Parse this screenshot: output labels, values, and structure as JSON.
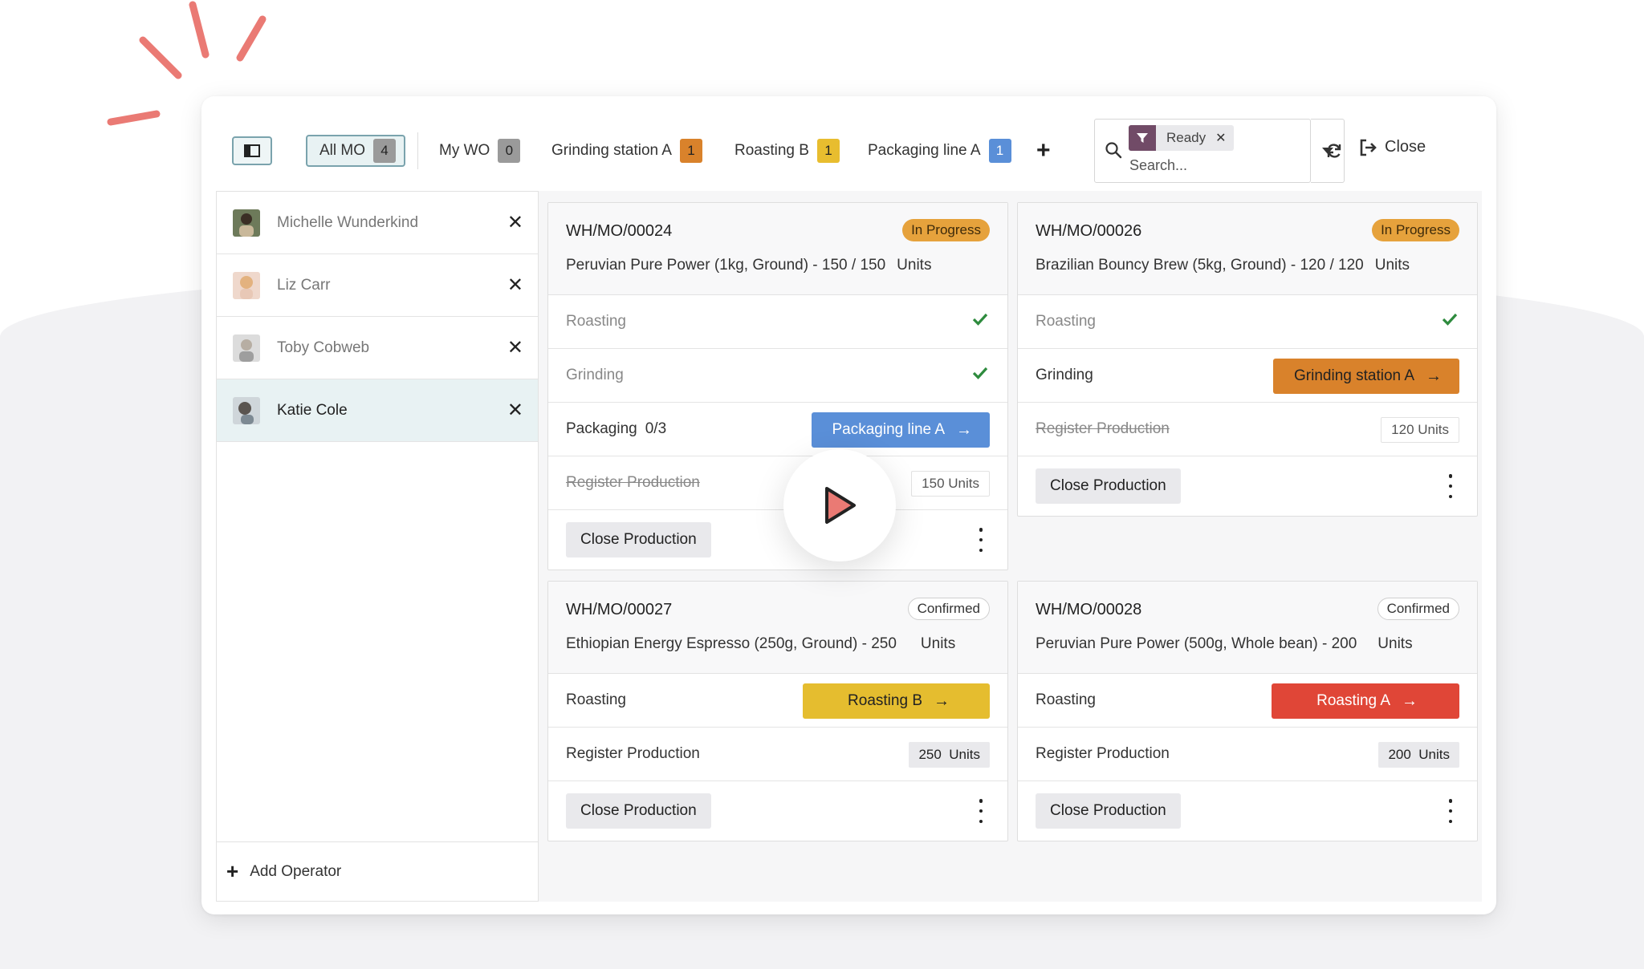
{
  "brand": {
    "accent": "#714b67",
    "sparkle": "#ea7a74"
  },
  "topbar": {
    "panel_toggle_icon": "sidebar-panel-icon",
    "tabs": [
      {
        "label": "All MO",
        "count": "4",
        "active": true,
        "badge_color": "#9a9a9a"
      },
      {
        "label": "My WO",
        "count": "0",
        "active": false,
        "badge_color": "#9a9a9a"
      },
      {
        "label": "Grinding station A",
        "count": "1",
        "active": false,
        "badge_color": "#d9822b"
      },
      {
        "label": "Roasting B",
        "count": "1",
        "active": false,
        "badge_color": "#e8bd2f"
      },
      {
        "label": "Packaging line A",
        "count": "1",
        "active": false,
        "badge_color": "#5a8fd8"
      }
    ],
    "add_tab_label": "+",
    "search": {
      "facet": "Ready",
      "facet_icon": "filter-icon",
      "placeholder": "Search..."
    },
    "refresh_icon": "refresh-icon",
    "close_label": "Close"
  },
  "operators": [
    {
      "name": "Michelle Wunderkind",
      "selected": false
    },
    {
      "name": "Liz Carr",
      "selected": false
    },
    {
      "name": "Toby Cobweb",
      "selected": false
    },
    {
      "name": "Katie Cole",
      "selected": true
    }
  ],
  "add_operator_label": "Add Operator",
  "cards": [
    {
      "ref": "WH/MO/00024",
      "status": "In Progress",
      "product": "Peruvian Pure Power (1kg, Ground) - 150 / 150",
      "uom": "Units",
      "rows": [
        {
          "name": "Roasting",
          "state": "done"
        },
        {
          "name": "Grinding",
          "state": "done"
        },
        {
          "name": "Packaging",
          "progress": "0/3",
          "button": "Packaging line A",
          "button_color": "#5a8fd8"
        },
        {
          "name": "Register Production",
          "struck": true,
          "qty": "150 Units"
        }
      ],
      "close_label": "Close Production"
    },
    {
      "ref": "WH/MO/00026",
      "status": "In Progress",
      "product": "Brazilian Bouncy Brew (5kg, Ground) - 120 / 120",
      "uom": "Units",
      "rows": [
        {
          "name": "Roasting",
          "state": "done"
        },
        {
          "name": "Grinding",
          "button": "Grinding station A",
          "button_color": "#d9822b"
        },
        {
          "name": "Register Production",
          "struck": true,
          "qty": "120 Units"
        }
      ],
      "close_label": "Close Production"
    },
    {
      "ref": "WH/MO/00027",
      "status": "Confirmed",
      "product": "Ethiopian Energy Espresso (250g, Ground) - 250",
      "uom": "Units",
      "rows": [
        {
          "name": "Roasting",
          "button": "Roasting B",
          "button_color": "#e5bd2f"
        },
        {
          "name": "Register Production",
          "qty_left": "250",
          "qty_right": "Units"
        }
      ],
      "close_label": "Close Production"
    },
    {
      "ref": "WH/MO/00028",
      "status": "Confirmed",
      "product": "Peruvian Pure Power (500g, Whole bean) - 200",
      "uom": "Units",
      "rows": [
        {
          "name": "Roasting",
          "button": "Roasting A",
          "button_color": "#e04637"
        },
        {
          "name": "Register Production",
          "qty_left": "200",
          "qty_right": "Units"
        }
      ],
      "close_label": "Close Production"
    }
  ],
  "video_overlay": {
    "icon": "play-icon"
  }
}
